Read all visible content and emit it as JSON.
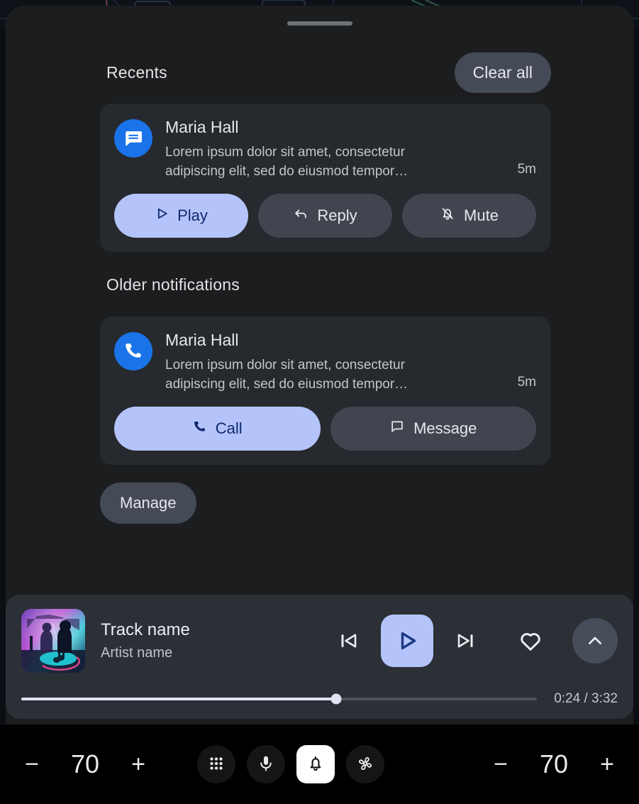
{
  "shade": {
    "drag_handle": "drag-handle",
    "recents": {
      "title": "Recents",
      "clear_all_label": "Clear all"
    },
    "older": {
      "title": "Older notifications"
    },
    "manage_label": "Manage",
    "notifications": [
      {
        "app_icon": "messages-icon",
        "sender": "Maria Hall",
        "message": "Lorem ipsum dolor sit amet, consectetur adipiscing elit, sed do eiusmod tempor…",
        "time": "5m",
        "actions": [
          {
            "label": "Play",
            "icon": "play-icon",
            "style": "primary"
          },
          {
            "label": "Reply",
            "icon": "reply-icon",
            "style": "secondary"
          },
          {
            "label": "Mute",
            "icon": "bell-off-icon",
            "style": "secondary"
          }
        ]
      },
      {
        "app_icon": "phone-icon",
        "sender": "Maria Hall",
        "message": "Lorem ipsum dolor sit amet, consectetur adipiscing elit, sed do eiusmod tempor…",
        "time": "5m",
        "actions": [
          {
            "label": "Call",
            "icon": "phone-icon",
            "style": "primary"
          },
          {
            "label": "Message",
            "icon": "message-icon",
            "style": "secondary"
          }
        ]
      }
    ]
  },
  "media": {
    "album_art": "concert-album-art",
    "track": "Track name",
    "artist": "Artist name",
    "controls": {
      "previous": "skip-previous-icon",
      "play": "play-icon",
      "next": "skip-next-icon",
      "favorite": "heart-icon",
      "expand": "chevron-up-icon"
    },
    "progress": {
      "elapsed": "0:24",
      "duration": "3:32",
      "time_display": "0:24 / 3:32",
      "percent": 61
    }
  },
  "bottom_bar": {
    "volume_left": {
      "minus": "−",
      "value": "70",
      "plus": "+"
    },
    "volume_right": {
      "minus": "−",
      "value": "70",
      "plus": "+"
    },
    "nav": [
      {
        "icon": "apps-grid-icon",
        "active": false
      },
      {
        "icon": "microphone-icon",
        "active": false
      },
      {
        "icon": "notifications-bell-icon",
        "active": true
      },
      {
        "icon": "fan-climate-icon",
        "active": false
      }
    ]
  },
  "colors": {
    "accent": "#b4c4fa",
    "accent_text": "#102a6e",
    "app_blue": "#1a73e8",
    "panel": "#1b1d1f",
    "card": "#26292e",
    "chip": "#454a57",
    "media_card": "#2b2f36"
  }
}
